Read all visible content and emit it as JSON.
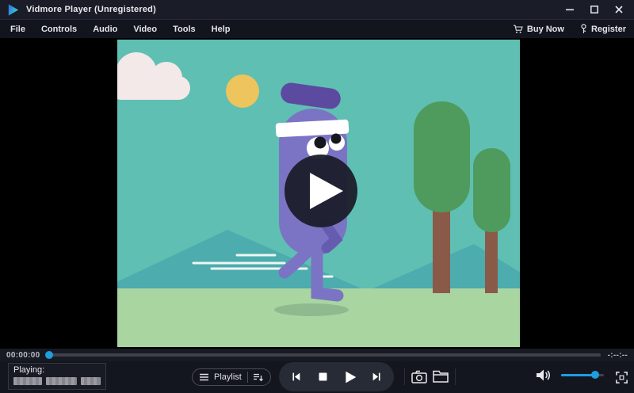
{
  "titlebar": {
    "title": "Vidmore Player (Unregistered)"
  },
  "menubar": {
    "items": [
      "File",
      "Controls",
      "Audio",
      "Video",
      "Tools",
      "Help"
    ],
    "buy_now_label": "Buy Now",
    "register_label": "Register"
  },
  "seekbar": {
    "elapsed": "00:00:00",
    "remaining": "-:--:--",
    "progress_percent": 0
  },
  "controls": {
    "playing_label": "Playing:",
    "playlist_label": "Playlist",
    "volume_percent": 79
  },
  "icons": {
    "app-logo": "blue-cyan play triangle",
    "minimize-icon": "–",
    "maximize-icon": "▢",
    "close-icon": "✕",
    "cart-icon": "shopping cart",
    "key-icon": "registration key",
    "playlist-menu-icon": "hamburger lines",
    "playlist-order-icon": "list with down arrow",
    "skip-back-icon": "previous track",
    "stop-icon": "stop square",
    "play-icon": "play triangle",
    "skip-forward-icon": "next track",
    "camera-icon": "snapshot camera",
    "folder-icon": "open media folder",
    "speaker-icon": "volume speaker",
    "fullscreen-icon": "expand corners"
  },
  "theme": {
    "titlebar_bg": "#1a1c28",
    "menubar_bg": "#12141e",
    "controlbar_bg": "#14161f",
    "accent_blue": "#1e9ddf"
  },
  "video_scene": {
    "alt": "cartoon purple jogging character with headband, teal sky, cloud, sun, mountains, two trees, green ground, play overlay",
    "colors": {
      "sky": "#5fbfb2",
      "mountain": "#4cacae",
      "ground": "#a9d5a1",
      "cloud": "#f3e9e9",
      "sun": "#eec45c",
      "tree": "#4f9b5e",
      "trunk": "#8a5a48",
      "character": "#7b74c4",
      "character_dark": "#5c4aa0",
      "overlay": "#1c1f2d"
    }
  }
}
